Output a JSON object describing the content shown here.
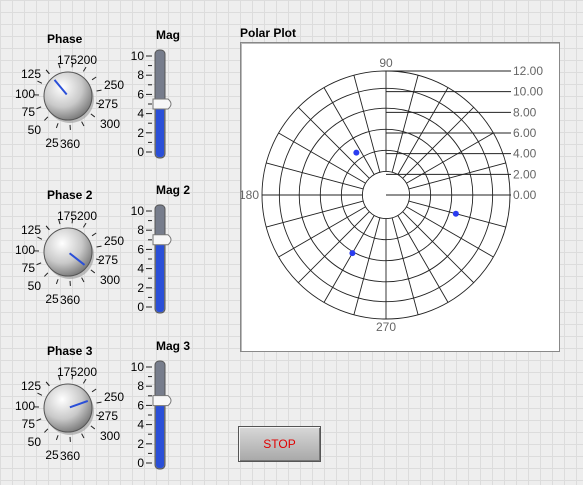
{
  "controls": [
    {
      "phase_label": "Phase",
      "mag_label": "Mag",
      "phase_ticks": [
        "175",
        "200",
        "125",
        "250",
        "100",
        "275",
        "75",
        "300",
        "50",
        "25",
        "360"
      ],
      "phase_value_deg": 125,
      "mag_ticks": [
        "10",
        "8",
        "6",
        "4",
        "2",
        "0"
      ],
      "mag_value": 5.0
    },
    {
      "phase_label": "Phase 2",
      "mag_label": "Mag 2",
      "phase_ticks": [
        "175",
        "200",
        "125",
        "250",
        "100",
        "275",
        "75",
        "300",
        "50",
        "25",
        "360"
      ],
      "phase_value_deg": 300,
      "mag_ticks": [
        "10",
        "8",
        "6",
        "4",
        "2",
        "0"
      ],
      "mag_value": 7.0
    },
    {
      "phase_label": "Phase 3",
      "mag_label": "Mag 3",
      "phase_ticks": [
        "175",
        "200",
        "125",
        "250",
        "100",
        "275",
        "75",
        "300",
        "50",
        "25",
        "360"
      ],
      "phase_value_deg": 240,
      "mag_ticks": [
        "10",
        "8",
        "6",
        "4",
        "2",
        "0"
      ],
      "mag_value": 6.5
    }
  ],
  "polar_plot": {
    "title": "Polar Plot",
    "angle_labels": [
      "90",
      "180",
      "270"
    ],
    "radius_labels": [
      "12.00",
      "10.00",
      "8.00",
      "6.00",
      "4.00",
      "2.00",
      "0.00"
    ],
    "points": [
      {
        "angle_deg": 125,
        "mag": 5.0
      },
      {
        "angle_deg": 345,
        "mag": 7.0
      },
      {
        "angle_deg": 240,
        "mag": 6.5
      }
    ],
    "point_color": "#2a3cf0"
  },
  "stop_button": {
    "label": "STOP",
    "text_color": "#e00000"
  },
  "accent_color": "#2a4fd8"
}
